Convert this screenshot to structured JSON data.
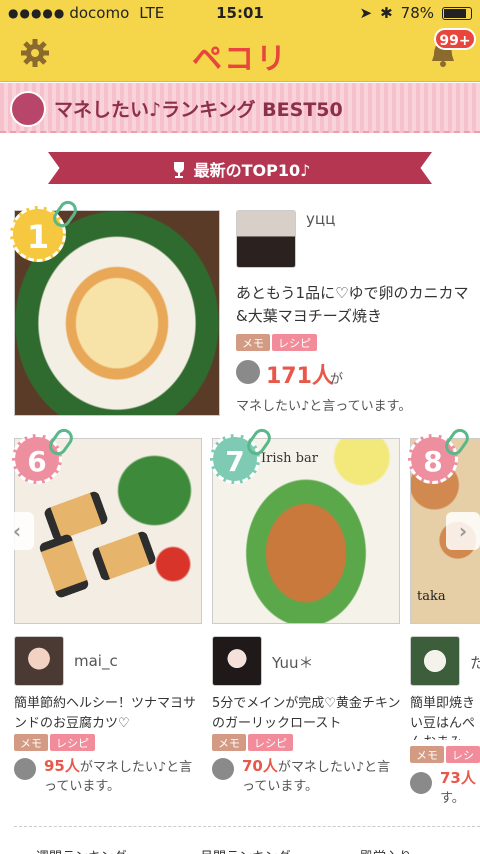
{
  "status_bar": {
    "signal": "●●●●●",
    "carrier": "docomo",
    "network": "LTE",
    "time": "15:01",
    "battery": "78%"
  },
  "nav": {
    "app_name": "ペコリ",
    "badge": "99+"
  },
  "section": {
    "title": "マネしたい♪ランキング BEST50"
  },
  "ribbon": {
    "label": "最新のTOP10♪"
  },
  "top_card": {
    "rank": "1",
    "user": "уцц",
    "title": "あともう1品に♡ゆで卵のカニカマ&大葉マヨチーズ焼き",
    "tags": [
      "メモ",
      "レシピ"
    ],
    "count": "171人",
    "count_suffix": "が",
    "said": "マネしたい♪と言っています。"
  },
  "cards": [
    {
      "rank": "6",
      "user": "mai_c",
      "title": "簡単節約ヘルシー！ツナマヨサンドのお豆腐カツ♡",
      "tags": [
        "メモ",
        "レシピ"
      ],
      "count": "95人",
      "said": "がマネしたい♪と言っています。"
    },
    {
      "rank": "7",
      "user": "Yuu＊",
      "title": "5分でメインが完成♡黄金チキンのガーリックロースト",
      "tags": [
        "メモ",
        "レシピ"
      ],
      "count": "70人",
      "said": "がマネしたい♪と言っています。",
      "photo_text": "Irish bar"
    },
    {
      "rank": "8",
      "user": "た",
      "title": "簡単即焼きい豆はんぺんおまみ",
      "tags": [
        "メモ",
        "レシピ"
      ],
      "count": "73人",
      "said": "す。",
      "photo_text": "taka"
    }
  ],
  "bottom_tabs": [
    "週間ランキング",
    "月間ランキング",
    "殿堂入り"
  ],
  "colors": {
    "accent_yellow": "#f5d64a",
    "brand_red": "#e8453c",
    "ribbon": "#b53651",
    "rank_green": "#7fcab2",
    "rank_pink": "#ee8fa0"
  }
}
